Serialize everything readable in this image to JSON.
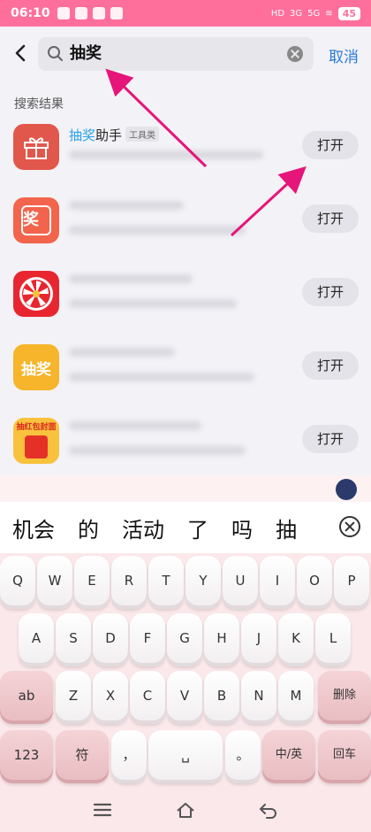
{
  "status": {
    "time": "06:10",
    "battery": "45",
    "network_1": "HD",
    "network_2": "3G",
    "network_3": "5G"
  },
  "search": {
    "query": "抽奖",
    "cancel_label": "取消"
  },
  "results": {
    "section_title": "搜索结果",
    "first_name_highlight": "抽奖",
    "first_name_rest": "助手",
    "first_tag": "工具类",
    "open_label": "打开",
    "icons": [
      "gift-icon",
      "jiang-icon",
      "wheel-icon",
      "choujiang-icon",
      "hongbao-icon"
    ],
    "icon2_text": "奖",
    "icon4_text": "抽奖",
    "icon5_text": "抽红包封面"
  },
  "keyboard": {
    "candidates": [
      "机会",
      "的",
      "活动",
      "了",
      "吗",
      "抽"
    ],
    "row1": [
      "Q",
      "W",
      "E",
      "R",
      "T",
      "Y",
      "U",
      "I",
      "O",
      "P"
    ],
    "row2": [
      "A",
      "S",
      "D",
      "F",
      "G",
      "H",
      "J",
      "K",
      "L"
    ],
    "row3": [
      "ab",
      "Z",
      "X",
      "C",
      "V",
      "B",
      "N",
      "M",
      "删除"
    ],
    "row4": [
      "123",
      "符",
      "，",
      "␣",
      "。",
      "中/英",
      "回车"
    ]
  },
  "colors": {
    "status_bar": "#ff6f9c",
    "accent_blue": "#2a7bd8",
    "arrow": "#e5157a"
  }
}
